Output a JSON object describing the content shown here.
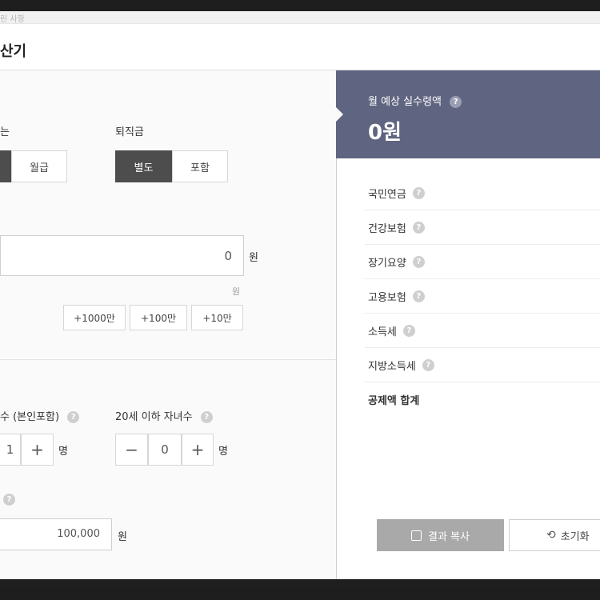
{
  "header": {
    "title": "산기",
    "strip_text": "린 사항"
  },
  "settings": {
    "pay_type_label": "는",
    "pay_type_options": [
      "",
      "월급"
    ],
    "severance_label": "퇴직금",
    "severance_options": [
      "별도",
      "포함"
    ]
  },
  "salary": {
    "value": "0",
    "unit": "원",
    "hint": "원",
    "quick_add": [
      "+1000만",
      "+100만",
      "+10만"
    ]
  },
  "dependents": {
    "label": "수 (본인포함)",
    "value": "1",
    "unit": "명",
    "minus": "−",
    "plus": "+"
  },
  "children": {
    "label": "20세 이하 자녀수",
    "value": "0",
    "unit": "명",
    "minus": "−",
    "plus": "+"
  },
  "nontax": {
    "value": "100,000",
    "unit": "원"
  },
  "result": {
    "label": "월 예상 실수령액",
    "value": "0원",
    "rows": [
      "국민연금",
      "건강보험",
      "장기요양",
      "고용보험",
      "소득세",
      "지방소득세"
    ],
    "total_label": "공제액 합계",
    "copy_button": "결과 복사",
    "reset_button": "초기화"
  },
  "help_glyph": "?"
}
